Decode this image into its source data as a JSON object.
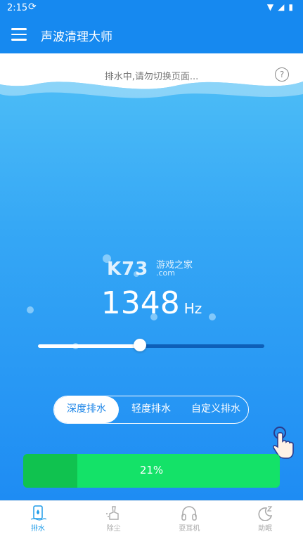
{
  "statusbar": {
    "time": "2:15"
  },
  "appbar": {
    "title": "声波清理大师"
  },
  "main": {
    "status_message": "排水中,请勿切换页面...",
    "help_symbol": "?",
    "watermark": {
      "brand": "K73",
      "cn": "游戏之家",
      "domain": ".com"
    },
    "frequency": {
      "value": "1348",
      "unit": "Hz"
    },
    "slider_level": 0.45,
    "modes": [
      {
        "label": "深度排水",
        "active": true
      },
      {
        "label": "轻度排水",
        "active": false
      },
      {
        "label": "自定义排水",
        "active": false
      }
    ],
    "progress": {
      "value": 0.21,
      "label": "21%"
    }
  },
  "bottom_nav": [
    {
      "label": "排水",
      "icon": "drain-phone-icon",
      "active": true
    },
    {
      "label": "除尘",
      "icon": "dust-clean-icon",
      "active": false
    },
    {
      "label": "耍耳机",
      "icon": "headphones-icon",
      "active": false
    },
    {
      "label": "助眠",
      "icon": "moon-sleep-icon",
      "active": false
    }
  ],
  "colors": {
    "primary": "#1689f0",
    "progress_fill": "#10c24f",
    "progress_track": "#14e268",
    "nav_active": "#1e9be8"
  }
}
